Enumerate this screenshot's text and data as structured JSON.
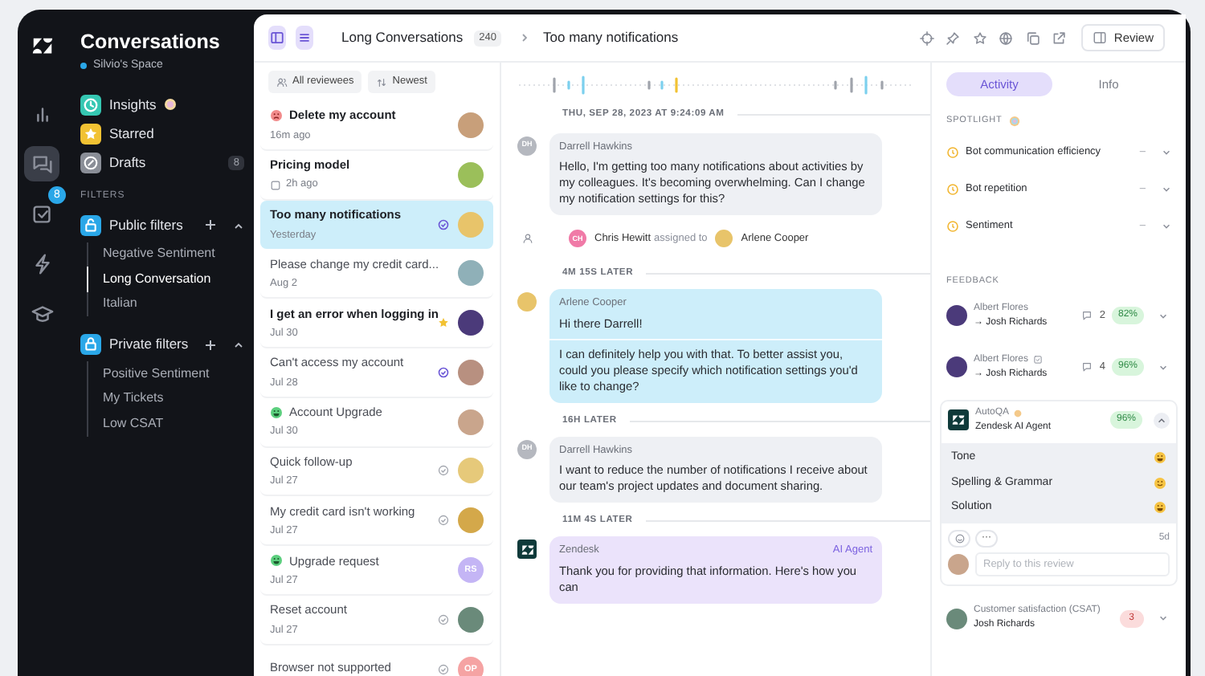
{
  "rail": [
    {
      "kind": "logo",
      "selected": false
    },
    {
      "kind": "chart",
      "selected": false
    },
    {
      "kind": "chat",
      "selected": true
    },
    {
      "kind": "tasks",
      "selected": false,
      "badge": "8"
    },
    {
      "kind": "bolt",
      "selected": false
    },
    {
      "kind": "cap",
      "selected": false
    }
  ],
  "sidebar": {
    "title": "Conversations",
    "space": "Silvio's Space",
    "nav": [
      {
        "kind": "insights",
        "label": "Insights"
      },
      {
        "kind": "starred",
        "label": "Starred"
      },
      {
        "kind": "drafts",
        "label": "Drafts",
        "badge": "8"
      }
    ],
    "filters_label": "FILTERS",
    "filter_groups": [
      {
        "label": "Public filters",
        "kind": "public",
        "expanded": true,
        "items": [
          {
            "label": "Negative Sentiment",
            "selected": false
          },
          {
            "label": "Long Conversation",
            "selected": true
          },
          {
            "label": "Italian",
            "selected": false
          }
        ]
      },
      {
        "label": "Private filters",
        "kind": "private",
        "expanded": true,
        "items": [
          {
            "label": "Positive Sentiment",
            "selected": false
          },
          {
            "label": "My Tickets",
            "selected": false
          },
          {
            "label": "Low CSAT",
            "selected": false
          }
        ]
      }
    ]
  },
  "header": {
    "list_title": "Long Conversations",
    "count": "240",
    "breadcrumb": "Too many notifications",
    "button": "Review"
  },
  "list": {
    "filters": [
      {
        "kind": "people",
        "label": "All reviewees"
      },
      {
        "kind": "sort",
        "label": "Newest"
      }
    ],
    "items": [
      {
        "title": "Delete my account",
        "time": "16m ago",
        "unread": true,
        "selected": false,
        "sentiment_icon": {
          "kind": "unhappy"
        }
      },
      {
        "title": "Pricing model",
        "time": "2h ago",
        "unread": true,
        "selected": false,
        "time_icon": {
          "kind": "draft"
        }
      },
      {
        "title": "Too many notifications",
        "time": "Yesterday",
        "unread": true,
        "selected": true,
        "status_icon": {
          "kind": "reviewed"
        }
      },
      {
        "title": "Please change my credit card...",
        "time": "Aug 2",
        "unread": false,
        "selected": false
      },
      {
        "title": "I get an error when logging in",
        "time": "Jul 30",
        "unread": true,
        "selected": false,
        "status_icon": {
          "kind": "starred"
        }
      },
      {
        "title": "Can't access my account",
        "time": "Jul 28",
        "unread": false,
        "selected": false,
        "status_icon": {
          "kind": "reviewed"
        }
      },
      {
        "title": "Account Upgrade",
        "time": "Jul 30",
        "unread": false,
        "selected": false,
        "sentiment_icon": {
          "kind": "happy"
        }
      },
      {
        "title": "Quick follow-up",
        "time": "Jul 27",
        "unread": false,
        "selected": false,
        "status_icon": {
          "kind": "checked"
        }
      },
      {
        "title": "My credit card isn't working",
        "time": "Jul 27",
        "unread": false,
        "selected": false,
        "status_icon": {
          "kind": "checked"
        }
      },
      {
        "title": "Upgrade request",
        "time": "Jul 27",
        "unread": false,
        "selected": false,
        "sentiment_icon": {
          "kind": "happy"
        },
        "initials": "RS",
        "color": "#c4b5f5"
      },
      {
        "title": "Reset account",
        "time": "Jul 27",
        "unread": false,
        "selected": false,
        "status_icon": {
          "kind": "checked"
        }
      },
      {
        "title": "Browser not supported",
        "unread": false,
        "selected": false,
        "status_icon": {
          "kind": "checked"
        },
        "initials": "OP",
        "color": "#f5a3a3"
      }
    ]
  },
  "conversation": {
    "events": [
      {
        "kind": "date",
        "text": "THU, SEP 28, 2023 AT 9:24:09 AM"
      },
      {
        "kind": "customer_message",
        "author": "Darrell Hawkins",
        "initials": "DH",
        "parts": [
          "Hello, I'm getting too many notifications about activities by my colleagues. It's becoming overwhelming. Can I change my notification settings for this?"
        ]
      },
      {
        "kind": "assign",
        "actor": "Chris Hewitt",
        "actor_initials": "CH",
        "verb": "assigned to",
        "assignee": "Arlene Cooper"
      },
      {
        "kind": "gap",
        "text": "4M 15S LATER"
      },
      {
        "kind": "agent_message",
        "author": "Arlene Cooper",
        "parts": [
          "Hi there Darrell!",
          "I can definitely help you with that. To better assist you, could you please specify which notification settings you'd like to change?"
        ]
      },
      {
        "kind": "gap",
        "text": "16H LATER"
      },
      {
        "kind": "customer_message",
        "author": "Darrell Hawkins",
        "initials": "DH",
        "parts": [
          "I want to reduce the number of notifications I receive about our team's project updates and document sharing."
        ]
      },
      {
        "kind": "gap",
        "text": "11M 4S LATER"
      },
      {
        "kind": "bot_message",
        "author": "Zendesk",
        "tag": "AI Agent",
        "parts": [
          "Thank you for providing that information. Here's how you can"
        ]
      }
    ]
  },
  "panel": {
    "tabs": [
      {
        "label": "Activity",
        "selected": true
      },
      {
        "label": "Info",
        "selected": false
      }
    ],
    "spotlight_label": "SPOTLIGHT",
    "spotlight": [
      {
        "label": "Bot communication efficiency",
        "value": "–"
      },
      {
        "label": "Bot repetition",
        "value": "–"
      },
      {
        "label": "Sentiment",
        "value": "–"
      }
    ],
    "feedback_label": "FEEDBACK",
    "feedback": [
      {
        "kind": "review",
        "reviewer": "Albert Flores",
        "reviewee": "→ Josh Richards",
        "edited": false,
        "comments": "2",
        "score": "82%",
        "expanded": false
      },
      {
        "kind": "review",
        "reviewer": "Albert Flores",
        "reviewee": "→ Josh Richards",
        "edited": true,
        "comments": "4",
        "score": "96%",
        "expanded": false
      },
      {
        "kind": "autoqa",
        "reviewer": "AutoQA",
        "reviewee": "Zendesk AI Agent",
        "score": "96%",
        "expanded": true,
        "categories": [
          {
            "label": "Tone",
            "kind": "grin"
          },
          {
            "label": "Spelling & Grammar",
            "kind": "smile"
          },
          {
            "label": "Solution",
            "kind": "grin"
          }
        ],
        "more": "···",
        "age": "5d",
        "reply_placeholder": "Reply to this review"
      },
      {
        "kind": "csat",
        "reviewer": "Customer satisfaction (CSAT)",
        "reviewee": "Josh Richards",
        "score": "3",
        "expanded": false
      }
    ]
  }
}
